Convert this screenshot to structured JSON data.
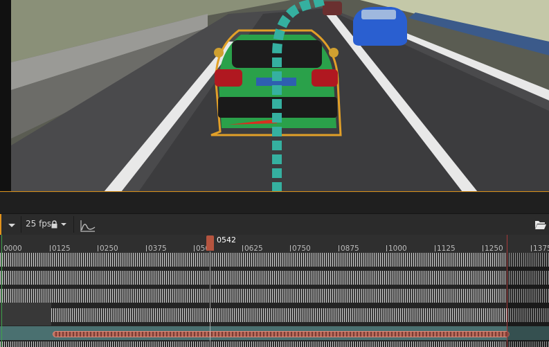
{
  "toolbar": {
    "playback_options_icon": "caret-down-icon",
    "fps_label": "25 fps",
    "lock_icon": "lock-icon",
    "fps_dropdown_icon": "caret-down-icon",
    "curve_editor_icon": "curve-icon",
    "open_folder_icon": "folder-open-icon",
    "accent_color": "#e2931c"
  },
  "timeline": {
    "ticks": [
      "0000",
      "0125",
      "0250",
      "0375",
      "0500",
      "0625",
      "0750",
      "0875",
      "1000",
      "1125",
      "1250",
      "1375"
    ],
    "playhead_frame": "0542",
    "playhead_color": "#b5543f",
    "end_marker_color": "#a83a3a",
    "start_marker_color": "#3fa24a"
  },
  "viewport": {
    "scene": "car driving on road",
    "selection_outline_color": "#e2a028"
  }
}
